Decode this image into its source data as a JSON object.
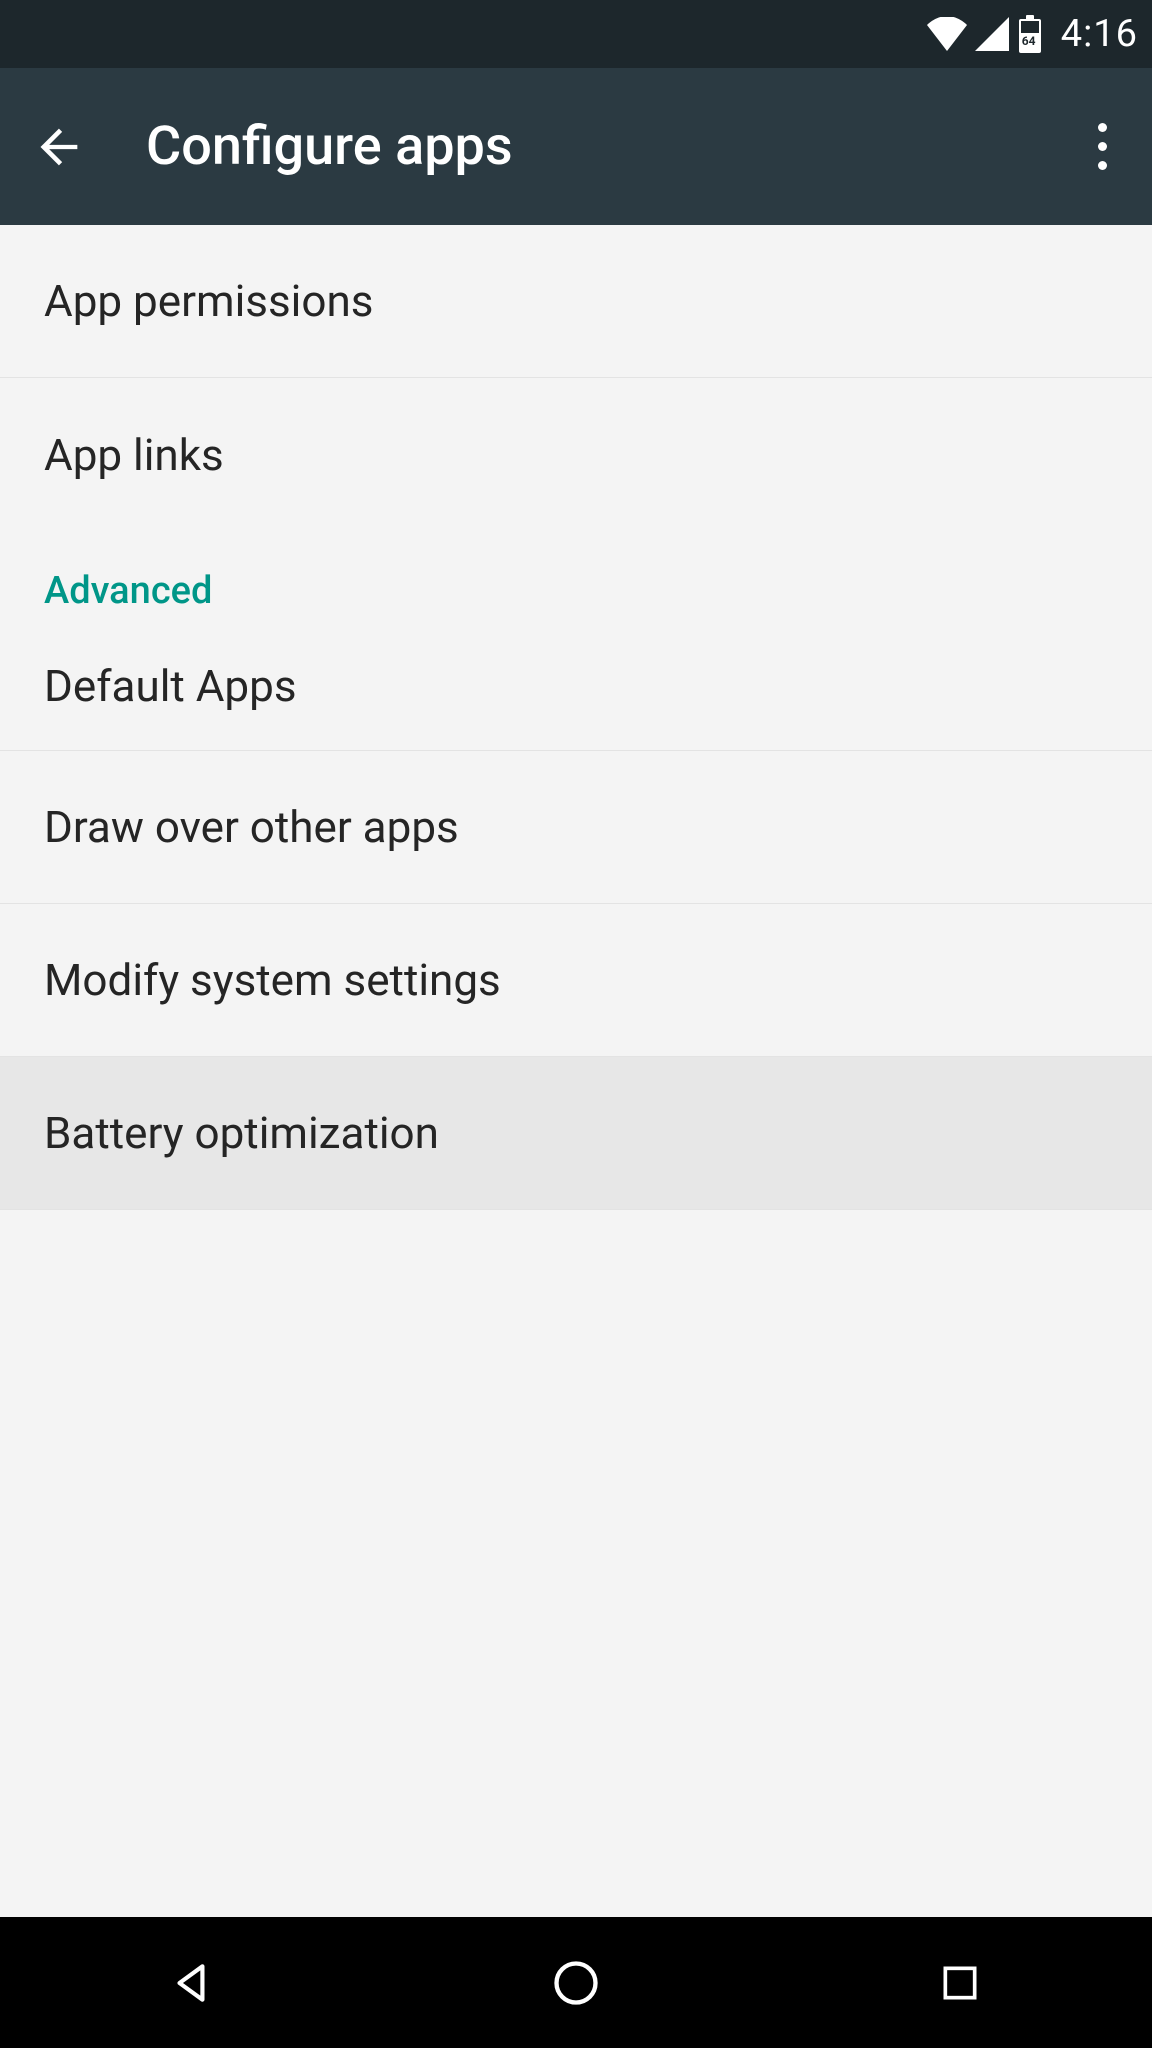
{
  "status": {
    "time": "4:16",
    "battery_level": "64"
  },
  "appbar": {
    "title": "Configure apps"
  },
  "sections": {
    "main": [
      {
        "label": "App permissions"
      },
      {
        "label": "App links"
      }
    ],
    "advanced_header": "Advanced",
    "advanced": [
      {
        "label": "Default Apps"
      },
      {
        "label": "Draw over other apps"
      },
      {
        "label": "Modify system settings"
      },
      {
        "label": "Battery optimization",
        "highlighted": true
      }
    ]
  }
}
